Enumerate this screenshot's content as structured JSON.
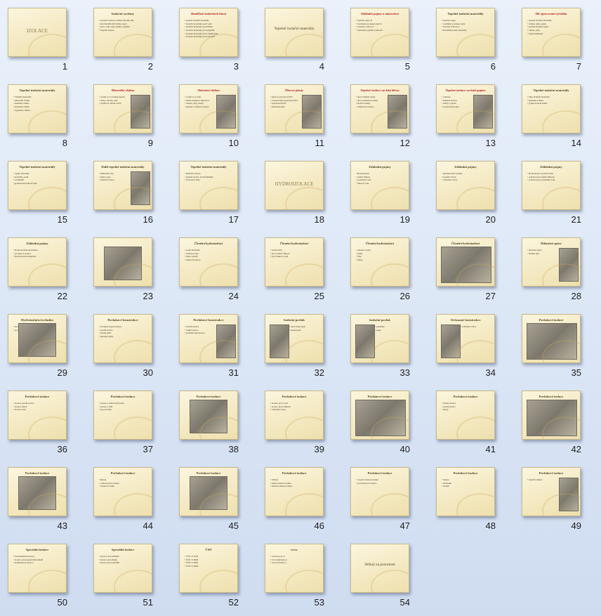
{
  "slides": [
    {
      "num": "1",
      "title": "IZOLACE",
      "style": "big",
      "bullets": [],
      "image": ""
    },
    {
      "num": "2",
      "title": "Izolační systémy",
      "style": "",
      "bullets": [
        "izolační soustavy chrání stavební dílo",
        "před škodlivými účinky okolí",
        "proti vodě, teplu, hluku, otřesům",
        "Tepelné izolace"
      ],
      "image": ""
    },
    {
      "num": "3",
      "title": "Rozdělení izolačních hmot",
      "style": "red",
      "bullets": [
        "tepelně izolační materiály",
        "izolační materiály proti vodě",
        "izolační materiály proti hluku",
        "izolační materiály proti plynům",
        "izolační materiály proti chemickým",
        "izolační materiály proti otřesům"
      ],
      "image": ""
    },
    {
      "num": "4",
      "title": "Tepelně izolační materiály",
      "style": "center",
      "bullets": [],
      "image": ""
    },
    {
      "num": "5",
      "title": "Základní pojmy a názvosloví",
      "style": "red",
      "bullets": [
        "Tepelný odpor R",
        "Součinitel prostupu tepla U",
        "Tepelná vodivost λ",
        "Součinitel tepelné vodivosti"
      ],
      "image": ""
    },
    {
      "num": "6",
      "title": "Tepelně izolační materiály",
      "style": "",
      "bullets": [
        "Tepelný odpor",
        "součinitel prostupu tepla",
        "Tepelná vodivost λ",
        "Rozdělení podle materiálu"
      ],
      "image": ""
    },
    {
      "num": "7",
      "title": "Dle zpracování výrobku",
      "style": "red",
      "bullets": [
        "tepelné izolační materiály",
        "vlákna, pěny, sypké",
        "tepelně izolační desky",
        "rohože, pásy",
        "sypké materiály"
      ],
      "image": ""
    },
    {
      "num": "8",
      "title": "Tepelně izolační materiály",
      "style": "",
      "bullets": [
        "Vláknité materiály",
        "minerální vlákna",
        "skleněná vlákna",
        "kamenná vlákna",
        "organické vlákna"
      ],
      "image": ""
    },
    {
      "num": "9",
      "title": "Minerální vlákna",
      "style": "red",
      "bullets": [
        "vyrábí se z taveniny hornin",
        "desky, rohože, pásy",
        "použití do střech a stěn"
      ],
      "image": "right"
    },
    {
      "num": "10",
      "title": "Skleněná vlákna",
      "style": "red",
      "bullets": [
        "vyrábí se ze skla",
        "nízká objemová hmotnost",
        "rohože, pásy, desky",
        "tepelná a zvuková izolace"
      ],
      "image": "right"
    },
    {
      "num": "11",
      "title": "Pěnové plasty",
      "style": "red",
      "bullets": [
        "pěnový polystyren EPS",
        "extrudovaný polystyren XPS",
        "polyuretan PUR",
        "fenolická pěna"
      ],
      "image": "right"
    },
    {
      "num": "12",
      "title": "Tepelné izolace na bázi dřeva",
      "style": "red",
      "bullets": [
        "dřevovláknité desky",
        "dřevocementové desky",
        "korkové desky",
        "celulózová izolace"
      ],
      "image": "right"
    },
    {
      "num": "13",
      "title": "Tepelné izolace na bázi papíru",
      "style": "red",
      "bullets": [
        "celulóza",
        "foukaná izolace",
        "desky z papíru",
        "recyklovaný papír"
      ],
      "image": "right"
    },
    {
      "num": "14",
      "title": "Tepelně izolační materiály",
      "style": "",
      "bullets": [
        "Sklo-vláknité materiály",
        "kamenná vlákna",
        "sypké izolační směsi"
      ],
      "image": ""
    },
    {
      "num": "15",
      "title": "Tepelně izolační materiály",
      "style": "",
      "bullets": [
        "Sypké materiály",
        "keramzit, perlit",
        "vermikulit",
        "granulovaná pěnová skla"
      ],
      "image": ""
    },
    {
      "num": "16",
      "title": "Další tepelné izolační materiály",
      "style": "",
      "bullets": [
        "Minerální vlna",
        "desky, pásy",
        "foukané izolace"
      ],
      "image": "right"
    },
    {
      "num": "17",
      "title": "Tepelně izolační materiály",
      "style": "",
      "bullets": [
        "Reflexní izolace",
        "tepelné izolace na bázi hliníku",
        "vícevrstvé fólie"
      ],
      "image": ""
    },
    {
      "num": "18",
      "title": "HYDROIZOLACE",
      "style": "big",
      "bullets": [],
      "image": ""
    },
    {
      "num": "19",
      "title": "Základní pojmy",
      "style": "",
      "bullets": [
        "Hydroizolace",
        "zemní vlhkost",
        "podzemní voda",
        "tlaková voda"
      ],
      "image": ""
    },
    {
      "num": "20",
      "title": "Základní pojmy",
      "style": "",
      "bullets": [
        "hydroizolační systém",
        "izolační vrstvy",
        "ochranné vrstvy"
      ],
      "image": ""
    },
    {
      "num": "21",
      "title": "Základní pojmy",
      "style": "",
      "bullets": [
        "Hydroizolace spodní stavby",
        "ochrana proti zemní vlhkosti",
        "ochrana proti podzemní vodě"
      ],
      "image": ""
    },
    {
      "num": "22",
      "title": "Základní pojmy",
      "style": "",
      "bullets": [
        "Hydroizolační konstrukce",
        "povlakové izolace",
        "hydroizolační materiály"
      ],
      "image": ""
    },
    {
      "num": "23",
      "title": "",
      "style": "",
      "bullets": [],
      "image": "center"
    },
    {
      "num": "24",
      "title": "Členění hydroizolací",
      "style": "",
      "bullets": [
        "podle materiálu",
        "asfaltové pásy",
        "fólie z plastů",
        "stěrkové izolace"
      ],
      "image": ""
    },
    {
      "num": "25",
      "title": "Členění hydroizolací",
      "style": "",
      "bullets": [
        "podle účelu",
        "proti zemní vlhkosti",
        "proti tlakové vodě"
      ],
      "image": ""
    },
    {
      "num": "26",
      "title": "Členění hydroizolací",
      "style": "",
      "bullets": [
        "Asfaltové pásy",
        "nátěry",
        "fólie",
        "stěrky"
      ],
      "image": ""
    },
    {
      "num": "27",
      "title": "Členění hydroizolací",
      "style": "",
      "bullets": [],
      "image": "full"
    },
    {
      "num": "28",
      "title": "Dilatační spáry",
      "style": "",
      "bullets": [
        "dilatační spáry",
        "těsnění spár"
      ],
      "image": "right"
    },
    {
      "num": "29",
      "title": "Hydroizolační technika",
      "style": "",
      "bullets": [
        "izolace",
        "podlahy"
      ],
      "image": "center"
    },
    {
      "num": "30",
      "title": "Povlakové konstrukce",
      "style": "",
      "bullets": [
        "Povlaková hydroizolace",
        "spodní stavba",
        "střešní plášť",
        "dilatační spáry"
      ],
      "image": ""
    },
    {
      "num": "31",
      "title": "Povlakové konstrukce",
      "style": "",
      "bullets": [
        "vnitřní izolace",
        "vnější izolace",
        "kombinovaná izolace"
      ],
      "image": "right"
    },
    {
      "num": "32",
      "title": "Izolační povlak",
      "style": "",
      "bullets": [
        "natavování pásů",
        "lepení pásů"
      ],
      "image": "left"
    },
    {
      "num": "33",
      "title": "Izolační povlak",
      "style": "",
      "bullets": [
        "pokládka",
        "spoje"
      ],
      "image": "left"
    },
    {
      "num": "34",
      "title": "Ochranné konstrukce",
      "style": "",
      "bullets": [
        "ochranná vrstva"
      ],
      "image": "left"
    },
    {
      "num": "35",
      "title": "Povlakové izolace",
      "style": "",
      "bullets": [],
      "image": "full"
    },
    {
      "num": "36",
      "title": "Povlakové izolace",
      "style": "",
      "bullets": [
        "izolace spodní stavby",
        "izolace střech",
        "izolace teras"
      ],
      "image": ""
    },
    {
      "num": "37",
      "title": "Povlakové izolace",
      "style": "",
      "bullets": [
        "izolace z asfaltových pásů",
        "izolace z fólií",
        "nopové fólie"
      ],
      "image": ""
    },
    {
      "num": "38",
      "title": "Povlakové izolace",
      "style": "",
      "bullets": [],
      "image": "center"
    },
    {
      "num": "39",
      "title": "Povlakové izolace",
      "style": "",
      "bullets": [
        "izolace proti vodě",
        "izolace proti vlhkosti",
        "ochranné vrstvy"
      ],
      "image": ""
    },
    {
      "num": "40",
      "title": "Povlakové izolace",
      "style": "",
      "bullets": [],
      "image": "full"
    },
    {
      "num": "41",
      "title": "Povlakové izolace",
      "style": "",
      "bullets": [
        "střešní izolace",
        "spodní stavba",
        "mosty"
      ],
      "image": ""
    },
    {
      "num": "42",
      "title": "Povlakové izolace",
      "style": "",
      "bullets": [],
      "image": "full"
    },
    {
      "num": "43",
      "title": "Povlakové izolace",
      "style": "",
      "bullets": [],
      "image": "center"
    },
    {
      "num": "44",
      "title": "Povlakové izolace",
      "style": "",
      "bullets": [
        "Radon",
        "ochrana proti radonu",
        "radonové riziko"
      ],
      "image": ""
    },
    {
      "num": "45",
      "title": "Povlakové izolace",
      "style": "",
      "bullets": [],
      "image": "center"
    },
    {
      "num": "46",
      "title": "Povlakové izolace",
      "style": "",
      "bullets": [
        "vlhkost",
        "nízké radonové riziko",
        "střední radonové riziko"
      ],
      "image": ""
    },
    {
      "num": "47",
      "title": "Povlakové izolace",
      "style": "",
      "bullets": [
        "vysoké radonové riziko",
        "protiradonová izolace"
      ],
      "image": ""
    },
    {
      "num": "48",
      "title": "Povlakové izolace",
      "style": "",
      "bullets": [
        "Sanace",
        "odvětrání",
        "drenáž"
      ],
      "image": ""
    },
    {
      "num": "49",
      "title": "Povlakové izolace",
      "style": "",
      "bullets": [
        "sanační omítky"
      ],
      "image": "right"
    },
    {
      "num": "50",
      "title": "Speciální izolace",
      "style": "",
      "bullets": [
        "Protichemické izolace",
        "izolace proti agresivním látkám",
        "Kameninové izolace"
      ],
      "image": ""
    },
    {
      "num": "51",
      "title": "Speciální izolace",
      "style": "",
      "bullets": [
        "Izolace proti kmitání",
        "Izolace proti hluku",
        "Izolace proti otřesům"
      ],
      "image": ""
    },
    {
      "num": "52",
      "title": "ČSN",
      "style": "",
      "bullets": [
        "ČSN 73 0540",
        "ČSN 73 0600",
        "ČSN 73 0601",
        "ČSN 73 0606"
      ],
      "image": ""
    },
    {
      "num": "53",
      "title": "www",
      "style": "",
      "bullets": [
        "www.isover.cz",
        "www.dektrade.cz",
        "www.tzb-info.cz"
      ],
      "image": ""
    },
    {
      "num": "54",
      "title": "Děkuji za pozornost",
      "style": "center",
      "bullets": [],
      "image": ""
    }
  ]
}
